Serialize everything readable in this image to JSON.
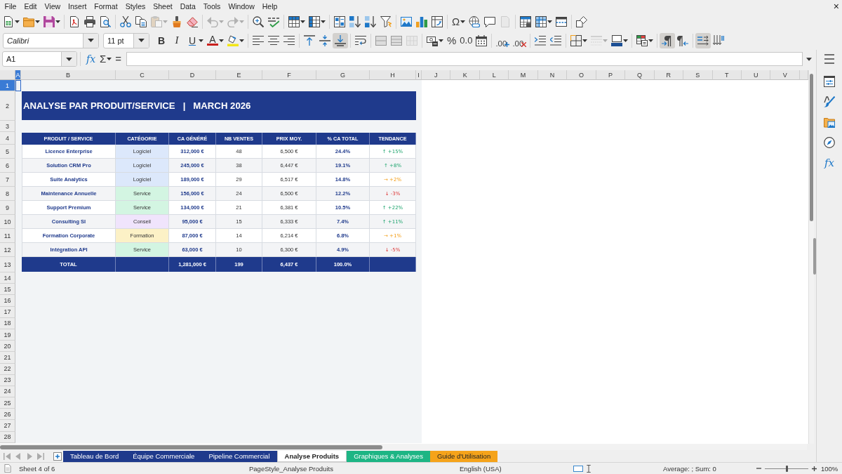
{
  "menu_bar": {
    "items": [
      "File",
      "Edit",
      "View",
      "Insert",
      "Format",
      "Styles",
      "Sheet",
      "Data",
      "Tools",
      "Window",
      "Help"
    ],
    "close": "×"
  },
  "standard_toolbar": {
    "paste": {
      "disabled": true
    },
    "undo": {
      "disabled": true
    },
    "redo": {
      "disabled": true
    },
    "special_character": "Ω",
    "headers_footers": {
      "disabled": true
    }
  },
  "formatting_toolbar": {
    "font_name": "Calibri",
    "font_size": "11 pt",
    "text_style": [
      {
        "label": "B",
        "on": false
      },
      {
        "label": "I",
        "on": false
      },
      {
        "label": "U",
        "on": false
      }
    ],
    "font_color": "A",
    "vertical_align": [
      {
        "on": false
      },
      {
        "on": false
      },
      {
        "on": true
      }
    ],
    "unmerge": {
      "disabled": true
    },
    "number_formats": [
      "%",
      "0.0"
    ],
    "decimal_places": [
      ".00",
      ".00"
    ],
    "border_style": {
      "disabled": true
    },
    "text_direction": [
      {
        "on": true
      },
      {
        "on": false
      }
    ],
    "text_orientation": [
      {
        "on": true
      },
      {
        "on": false
      }
    ]
  },
  "formula_bar": {
    "name_box": "A1",
    "function_wizard": "fx",
    "sum": "Σ",
    "formula": "="
  },
  "column_headers": [
    {
      "label": "A",
      "selected": true
    },
    {
      "label": "B",
      "selected": false
    },
    {
      "label": "C",
      "selected": false
    },
    {
      "label": "D",
      "selected": false
    },
    {
      "label": "E",
      "selected": false
    },
    {
      "label": "F",
      "selected": false
    },
    {
      "label": "G",
      "selected": false
    },
    {
      "label": "H",
      "selected": false
    },
    {
      "label": "I",
      "selected": false
    },
    {
      "label": "J",
      "selected": false
    },
    {
      "label": "K",
      "selected": false
    },
    {
      "label": "L",
      "selected": false
    },
    {
      "label": "M",
      "selected": false
    },
    {
      "label": "N",
      "selected": false
    },
    {
      "label": "O",
      "selected": false
    },
    {
      "label": "P",
      "selected": false
    },
    {
      "label": "Q",
      "selected": false
    },
    {
      "label": "R",
      "selected": false
    },
    {
      "label": "S",
      "selected": false
    },
    {
      "label": "T",
      "selected": false
    },
    {
      "label": "U",
      "selected": false
    },
    {
      "label": "V",
      "selected": false
    }
  ],
  "row_headers": [
    {
      "label": "1",
      "selected": true
    },
    {
      "label": "2",
      "selected": false
    },
    {
      "label": "3",
      "selected": false
    },
    {
      "label": "4",
      "selected": false
    },
    {
      "label": "5",
      "selected": false
    },
    {
      "label": "6",
      "selected": false
    },
    {
      "label": "7",
      "selected": false
    },
    {
      "label": "8",
      "selected": false
    },
    {
      "label": "9",
      "selected": false
    },
    {
      "label": "10",
      "selected": false
    },
    {
      "label": "11",
      "selected": false
    },
    {
      "label": "12",
      "selected": false
    },
    {
      "label": "13",
      "selected": false
    },
    {
      "label": "14",
      "selected": false
    },
    {
      "label": "15",
      "selected": false
    },
    {
      "label": "16",
      "selected": false
    },
    {
      "label": "17",
      "selected": false
    },
    {
      "label": "18",
      "selected": false
    },
    {
      "label": "19",
      "selected": false
    },
    {
      "label": "20",
      "selected": false
    },
    {
      "label": "21",
      "selected": false
    },
    {
      "label": "22",
      "selected": false
    },
    {
      "label": "23",
      "selected": false
    },
    {
      "label": "24",
      "selected": false
    },
    {
      "label": "25",
      "selected": false
    },
    {
      "label": "26",
      "selected": false
    },
    {
      "label": "27",
      "selected": false
    },
    {
      "label": "28",
      "selected": false
    }
  ],
  "sheet": {
    "title": "ANALYSE PAR PRODUIT/SERVICE   |   MARCH 2026",
    "table": {
      "columns": [
        "PRODUIT / SERVICE",
        "CATÉGORIE",
        "CA GÉNÉRÉ",
        "NB VENTES",
        "PRIX MOY.",
        "% CA TOTAL",
        "TENDANCE"
      ],
      "rows": [
        {
          "product": "Licence Enterprise",
          "category": {
            "label": "Logiciel",
            "color": "#dce8fb"
          },
          "revenue": "312,000 €",
          "sales": "48",
          "avg_price": "6,500 €",
          "share": "24.4%",
          "trend": {
            "label": "↑ +15%",
            "kind": "up"
          }
        },
        {
          "product": "Solution CRM Pro",
          "category": {
            "label": "Logiciel",
            "color": "#dce8fb"
          },
          "revenue": "245,000 €",
          "sales": "38",
          "avg_price": "6,447 €",
          "share": "19.1%",
          "trend": {
            "label": "↑ +8%",
            "kind": "up"
          }
        },
        {
          "product": "Suite Analytics",
          "category": {
            "label": "Logiciel",
            "color": "#dce8fb"
          },
          "revenue": "189,000 €",
          "sales": "29",
          "avg_price": "6,517 €",
          "share": "14.8%",
          "trend": {
            "label": "→ +2%",
            "kind": "flat"
          }
        },
        {
          "product": "Maintenance Annuelle",
          "category": {
            "label": "Service",
            "color": "#d3f5e2"
          },
          "revenue": "156,000 €",
          "sales": "24",
          "avg_price": "6,500 €",
          "share": "12.2%",
          "trend": {
            "label": "↓ -3%",
            "kind": "down"
          }
        },
        {
          "product": "Support Premium",
          "category": {
            "label": "Service",
            "color": "#d3f5e2"
          },
          "revenue": "134,000 €",
          "sales": "21",
          "avg_price": "6,381 €",
          "share": "10.5%",
          "trend": {
            "label": "↑ +22%",
            "kind": "up"
          }
        },
        {
          "product": "Consulting SI",
          "category": {
            "label": "Conseil",
            "color": "#f0e4fc"
          },
          "revenue": "95,000 €",
          "sales": "15",
          "avg_price": "6,333 €",
          "share": "7.4%",
          "trend": {
            "label": "↑ +11%",
            "kind": "up"
          }
        },
        {
          "product": "Formation Corporate",
          "category": {
            "label": "Formation",
            "color": "#fcf1c6"
          },
          "revenue": "87,000 €",
          "sales": "14",
          "avg_price": "6,214 €",
          "share": "6.8%",
          "trend": {
            "label": "→ +1%",
            "kind": "flat"
          }
        },
        {
          "product": "Intégration API",
          "category": {
            "label": "Service",
            "color": "#d3f5e2"
          },
          "revenue": "63,000 €",
          "sales": "10",
          "avg_price": "6,300 €",
          "share": "4.9%",
          "trend": {
            "label": "↓ -5%",
            "kind": "down"
          }
        }
      ],
      "total": {
        "label": "TOTAL",
        "revenue": "1,281,000 €",
        "sales": "199",
        "avg_price": "6,437 €",
        "share": "100.0%"
      }
    }
  },
  "sheet_tabs": [
    {
      "label": "Tableau de Bord",
      "color": "#1f3a8c",
      "selected": false
    },
    {
      "label": "Équipe Commerciale",
      "color": "#1f3a8c",
      "selected": false
    },
    {
      "label": "Pipeline Commercial",
      "color": "#1f3a8c",
      "selected": false
    },
    {
      "label": "Analyse Produits",
      "selected": true
    },
    {
      "label": "Graphiques & Analyses",
      "color": "#1db584",
      "selected": false
    },
    {
      "label": "Guide d'Utilisation",
      "color": "#f5a31a",
      "selected": false
    }
  ],
  "sidebar": {
    "functions": "fx"
  },
  "status_bar": {
    "sheet_position": "Sheet 4 of 6",
    "page_style": "PageStyle_Analyse Produits",
    "language": "English (USA)",
    "selection_summary": "Average: ; Sum: 0",
    "zoom": {
      "level": 0.5,
      "reading": "100%"
    }
  }
}
